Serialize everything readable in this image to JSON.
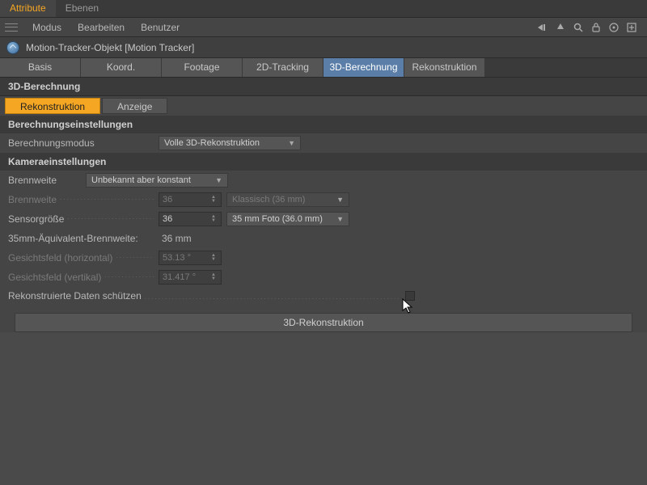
{
  "topTabs": {
    "attribute": "Attribute",
    "ebenen": "Ebenen"
  },
  "menu": {
    "modus": "Modus",
    "bearbeiten": "Bearbeiten",
    "benutzer": "Benutzer"
  },
  "object": {
    "title": "Motion-Tracker-Objekt [Motion Tracker]"
  },
  "mainTabs": {
    "basis": "Basis",
    "koord": "Koord.",
    "footage": "Footage",
    "tracking2d": "2D-Tracking",
    "berechnung3d": "3D-Berechnung",
    "rekonstruktion": "Rekonstruktion"
  },
  "section": {
    "title": "3D-Berechnung"
  },
  "subTabs": {
    "rekonstruktion": "Rekonstruktion",
    "anzeige": "Anzeige"
  },
  "groups": {
    "berechnung": "Berechnungseinstellungen",
    "kamera": "Kameraeinstellungen"
  },
  "fields": {
    "berechnungsmodus": {
      "label": "Berechnungsmodus",
      "value": "Volle 3D-Rekonstruktion"
    },
    "brennweiteDrop": {
      "label": "Brennweite",
      "value": "Unbekannt aber konstant"
    },
    "brennweiteNum": {
      "label": "Brennweite",
      "value": "36",
      "preset": "Klassisch (36 mm)"
    },
    "sensorgroesse": {
      "label": "Sensorgröße",
      "value": "36",
      "preset": "35 mm Foto (36.0 mm)"
    },
    "equiv35": {
      "label": "35mm-Äquivalent-Brennweite:",
      "value": "36 mm"
    },
    "gfHorizontal": {
      "label": "Gesichtsfeld (horizontal)",
      "value": "53.13 °"
    },
    "gfVertikal": {
      "label": "Gesichtsfeld (vertikal)",
      "value": "31.417 °"
    },
    "protectData": {
      "label": "Rekonstruierte Daten schützen"
    }
  },
  "button": {
    "run": "3D-Rekonstruktion"
  }
}
